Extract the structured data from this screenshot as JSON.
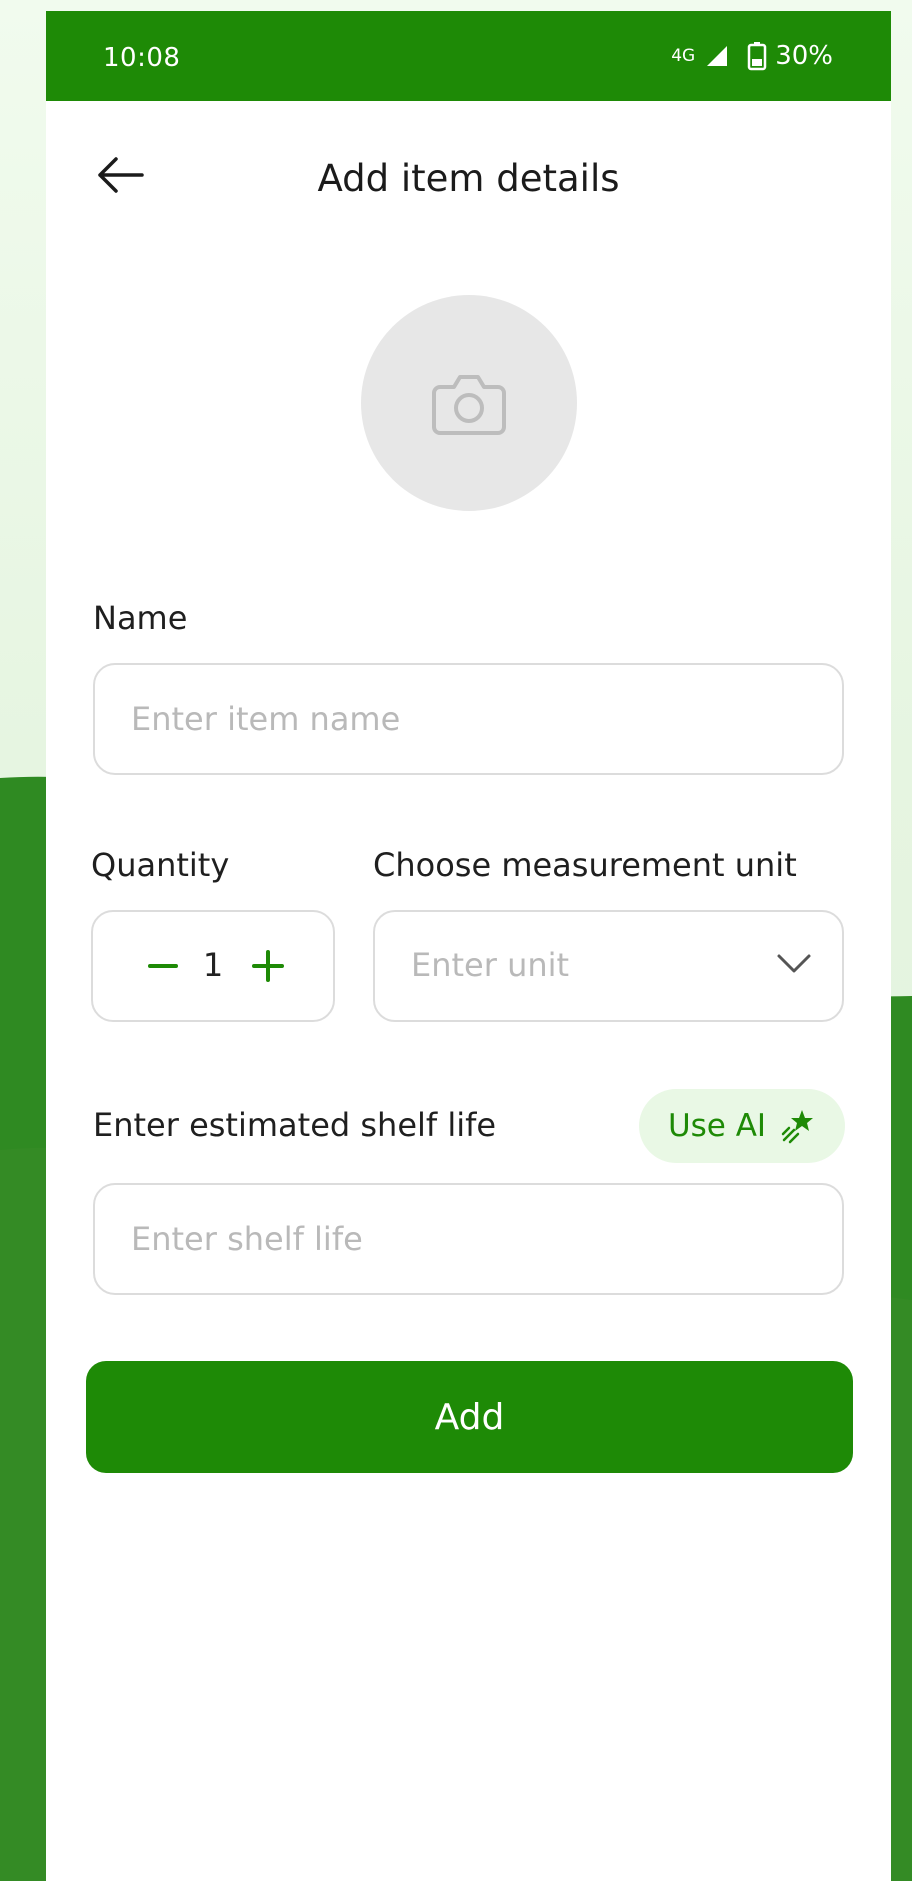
{
  "status_bar": {
    "time": "10:08",
    "network": "4G",
    "battery": "30%"
  },
  "header": {
    "back_icon": "arrow-left-icon",
    "title": "Add item details"
  },
  "photo": {
    "icon": "camera-icon"
  },
  "name_field": {
    "label": "Name",
    "placeholder": "Enter item name",
    "value": ""
  },
  "quantity": {
    "label": "Quantity",
    "value": "1",
    "decrement_icon": "minus-icon",
    "increment_icon": "plus-icon"
  },
  "unit": {
    "label": "Choose measurement unit",
    "placeholder": "Enter unit",
    "icon": "chevron-down-icon"
  },
  "shelf_life": {
    "label": "Enter estimated shelf life",
    "placeholder": "Enter shelf life",
    "value": "",
    "ai_button_label": "Use AI",
    "ai_icon": "sparkle-star-icon"
  },
  "actions": {
    "add_label": "Add"
  },
  "colors": {
    "primary": "#1e8a06",
    "ai_chip_bg": "#e9f8e5",
    "photo_bg": "#e7e7e7",
    "border": "#dcdcdc",
    "placeholder": "#b9b9b9"
  }
}
